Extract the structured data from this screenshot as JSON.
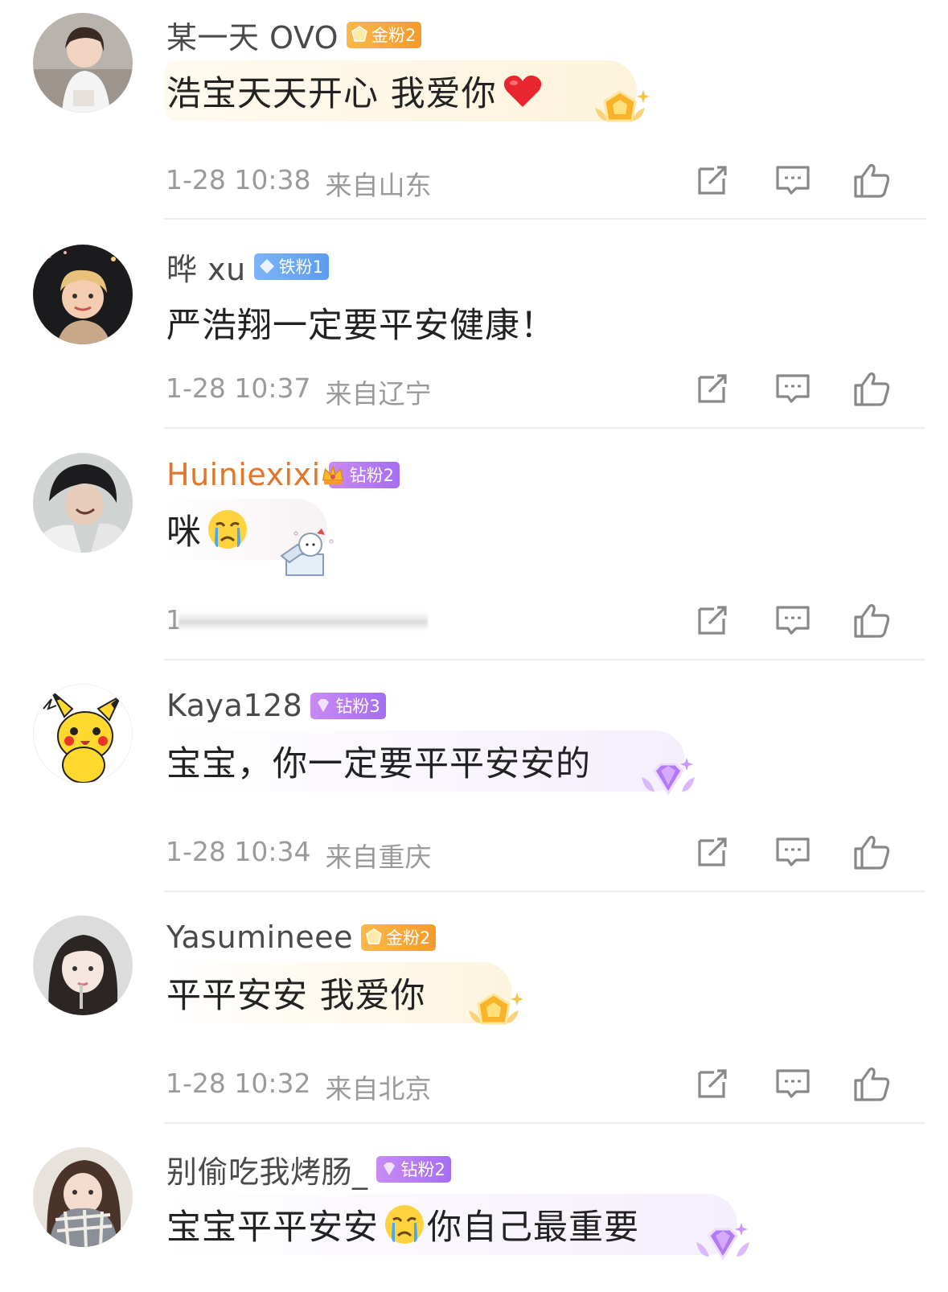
{
  "comments": [
    {
      "username": "某一天 OVO",
      "badge": {
        "label": "金粉2",
        "type": "gold",
        "color": "#f7a234"
      },
      "text": "浩宝天天开心 我爱你",
      "emoji": "red-heart",
      "bubble_deco": "gold-badge-wings",
      "date": "1-28 10:38",
      "location": "来自山东"
    },
    {
      "username": "晔 xu",
      "badge": {
        "label": "铁粉1",
        "type": "iron",
        "color": "#5c9cf0"
      },
      "text": "严浩翔一定要平安健康！",
      "emoji": "",
      "bubble_deco": "",
      "date": "1-28 10:37",
      "location": "来自辽宁"
    },
    {
      "username": "Huiniexixi",
      "badge": {
        "label": "钻粉2",
        "type": "diamond-crown",
        "color": "#b86ff0"
      },
      "text": "咪",
      "emoji": "crying-face",
      "bubble_deco": "kitty-gift-box",
      "date": "1",
      "location": "",
      "obscured_meta": true
    },
    {
      "username": "Kaya128",
      "badge": {
        "label": "钻粉3",
        "type": "diamond",
        "color": "#a56ef2"
      },
      "text": "宝宝，你一定要平平安安的",
      "emoji": "",
      "bubble_deco": "purple-diamond-wings",
      "date": "1-28 10:34",
      "location": "来自重庆"
    },
    {
      "username": "Yasumineee",
      "badge": {
        "label": "金粉2",
        "type": "gold",
        "color": "#f7a234"
      },
      "text": "平平安安 我爱你",
      "emoji": "",
      "bubble_deco": "gold-badge-wings",
      "date": "1-28 10:32",
      "location": "来自北京"
    },
    {
      "username": "别偷吃我烤肠_",
      "badge": {
        "label": "钻粉2",
        "type": "diamond",
        "color": "#a56ef2"
      },
      "text": "宝宝平平安安",
      "text_after_emoji": "你自己最重要",
      "emoji": "crying-face",
      "bubble_deco": "purple-diamond-wings"
    }
  ],
  "icons": {
    "repost": "repost-icon",
    "comment": "comment-icon",
    "like": "thumbs-up-icon"
  }
}
